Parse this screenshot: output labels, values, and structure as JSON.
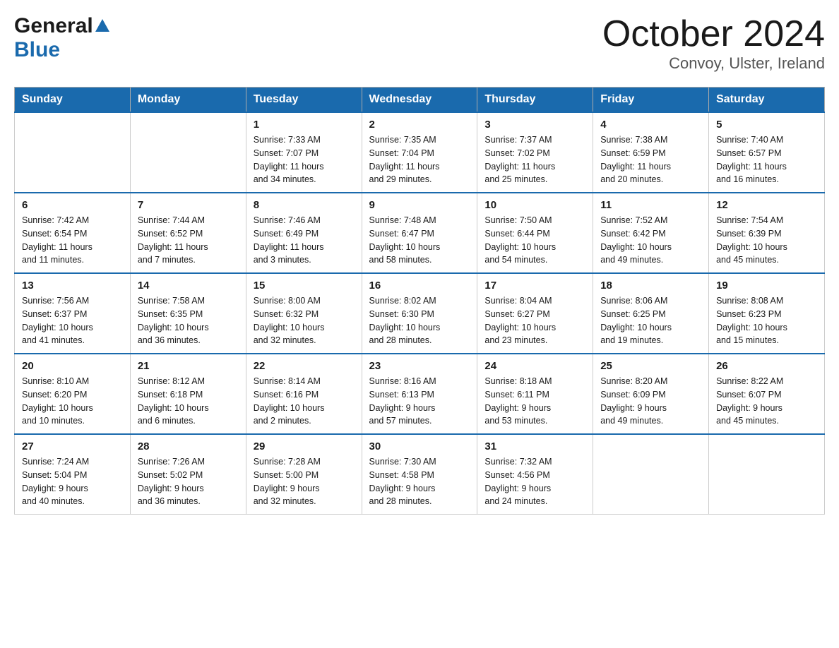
{
  "header": {
    "logo_line1": "General",
    "logo_line2": "Blue",
    "title": "October 2024",
    "subtitle": "Convoy, Ulster, Ireland"
  },
  "days_of_week": [
    "Sunday",
    "Monday",
    "Tuesday",
    "Wednesday",
    "Thursday",
    "Friday",
    "Saturday"
  ],
  "weeks": [
    [
      {
        "day": "",
        "info": ""
      },
      {
        "day": "",
        "info": ""
      },
      {
        "day": "1",
        "info": "Sunrise: 7:33 AM\nSunset: 7:07 PM\nDaylight: 11 hours\nand 34 minutes."
      },
      {
        "day": "2",
        "info": "Sunrise: 7:35 AM\nSunset: 7:04 PM\nDaylight: 11 hours\nand 29 minutes."
      },
      {
        "day": "3",
        "info": "Sunrise: 7:37 AM\nSunset: 7:02 PM\nDaylight: 11 hours\nand 25 minutes."
      },
      {
        "day": "4",
        "info": "Sunrise: 7:38 AM\nSunset: 6:59 PM\nDaylight: 11 hours\nand 20 minutes."
      },
      {
        "day": "5",
        "info": "Sunrise: 7:40 AM\nSunset: 6:57 PM\nDaylight: 11 hours\nand 16 minutes."
      }
    ],
    [
      {
        "day": "6",
        "info": "Sunrise: 7:42 AM\nSunset: 6:54 PM\nDaylight: 11 hours\nand 11 minutes."
      },
      {
        "day": "7",
        "info": "Sunrise: 7:44 AM\nSunset: 6:52 PM\nDaylight: 11 hours\nand 7 minutes."
      },
      {
        "day": "8",
        "info": "Sunrise: 7:46 AM\nSunset: 6:49 PM\nDaylight: 11 hours\nand 3 minutes."
      },
      {
        "day": "9",
        "info": "Sunrise: 7:48 AM\nSunset: 6:47 PM\nDaylight: 10 hours\nand 58 minutes."
      },
      {
        "day": "10",
        "info": "Sunrise: 7:50 AM\nSunset: 6:44 PM\nDaylight: 10 hours\nand 54 minutes."
      },
      {
        "day": "11",
        "info": "Sunrise: 7:52 AM\nSunset: 6:42 PM\nDaylight: 10 hours\nand 49 minutes."
      },
      {
        "day": "12",
        "info": "Sunrise: 7:54 AM\nSunset: 6:39 PM\nDaylight: 10 hours\nand 45 minutes."
      }
    ],
    [
      {
        "day": "13",
        "info": "Sunrise: 7:56 AM\nSunset: 6:37 PM\nDaylight: 10 hours\nand 41 minutes."
      },
      {
        "day": "14",
        "info": "Sunrise: 7:58 AM\nSunset: 6:35 PM\nDaylight: 10 hours\nand 36 minutes."
      },
      {
        "day": "15",
        "info": "Sunrise: 8:00 AM\nSunset: 6:32 PM\nDaylight: 10 hours\nand 32 minutes."
      },
      {
        "day": "16",
        "info": "Sunrise: 8:02 AM\nSunset: 6:30 PM\nDaylight: 10 hours\nand 28 minutes."
      },
      {
        "day": "17",
        "info": "Sunrise: 8:04 AM\nSunset: 6:27 PM\nDaylight: 10 hours\nand 23 minutes."
      },
      {
        "day": "18",
        "info": "Sunrise: 8:06 AM\nSunset: 6:25 PM\nDaylight: 10 hours\nand 19 minutes."
      },
      {
        "day": "19",
        "info": "Sunrise: 8:08 AM\nSunset: 6:23 PM\nDaylight: 10 hours\nand 15 minutes."
      }
    ],
    [
      {
        "day": "20",
        "info": "Sunrise: 8:10 AM\nSunset: 6:20 PM\nDaylight: 10 hours\nand 10 minutes."
      },
      {
        "day": "21",
        "info": "Sunrise: 8:12 AM\nSunset: 6:18 PM\nDaylight: 10 hours\nand 6 minutes."
      },
      {
        "day": "22",
        "info": "Sunrise: 8:14 AM\nSunset: 6:16 PM\nDaylight: 10 hours\nand 2 minutes."
      },
      {
        "day": "23",
        "info": "Sunrise: 8:16 AM\nSunset: 6:13 PM\nDaylight: 9 hours\nand 57 minutes."
      },
      {
        "day": "24",
        "info": "Sunrise: 8:18 AM\nSunset: 6:11 PM\nDaylight: 9 hours\nand 53 minutes."
      },
      {
        "day": "25",
        "info": "Sunrise: 8:20 AM\nSunset: 6:09 PM\nDaylight: 9 hours\nand 49 minutes."
      },
      {
        "day": "26",
        "info": "Sunrise: 8:22 AM\nSunset: 6:07 PM\nDaylight: 9 hours\nand 45 minutes."
      }
    ],
    [
      {
        "day": "27",
        "info": "Sunrise: 7:24 AM\nSunset: 5:04 PM\nDaylight: 9 hours\nand 40 minutes."
      },
      {
        "day": "28",
        "info": "Sunrise: 7:26 AM\nSunset: 5:02 PM\nDaylight: 9 hours\nand 36 minutes."
      },
      {
        "day": "29",
        "info": "Sunrise: 7:28 AM\nSunset: 5:00 PM\nDaylight: 9 hours\nand 32 minutes."
      },
      {
        "day": "30",
        "info": "Sunrise: 7:30 AM\nSunset: 4:58 PM\nDaylight: 9 hours\nand 28 minutes."
      },
      {
        "day": "31",
        "info": "Sunrise: 7:32 AM\nSunset: 4:56 PM\nDaylight: 9 hours\nand 24 minutes."
      },
      {
        "day": "",
        "info": ""
      },
      {
        "day": "",
        "info": ""
      }
    ]
  ]
}
